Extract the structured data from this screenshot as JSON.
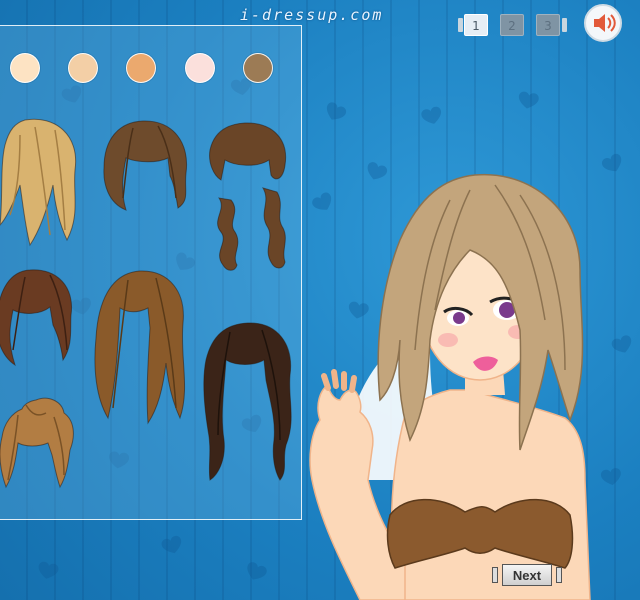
{
  "header": {
    "site_logo": "i-dressup.com"
  },
  "pages": {
    "items": [
      "1",
      "2",
      "3"
    ],
    "active": "1"
  },
  "skin_tones": [
    "#fde3c3",
    "#f3cfa6",
    "#eba96e",
    "#fbe0dc",
    "#9c7b55"
  ],
  "hairstyles": [
    {
      "name": "blonde-layered",
      "color": "#d9b36f"
    },
    {
      "name": "brown-bob",
      "color": "#6e4b2c"
    },
    {
      "name": "brown-long-curls",
      "color": "#6a4527"
    },
    {
      "name": "auburn-short",
      "color": "#6a3b22"
    },
    {
      "name": "caramel-long",
      "color": "#8a5a2a"
    },
    {
      "name": "dark-brown-long-wavy",
      "color": "#3b2418"
    },
    {
      "name": "honey-updo",
      "color": "#b27d43"
    }
  ],
  "controls": {
    "sound_icon": "speaker-icon",
    "next_label": "Next"
  }
}
